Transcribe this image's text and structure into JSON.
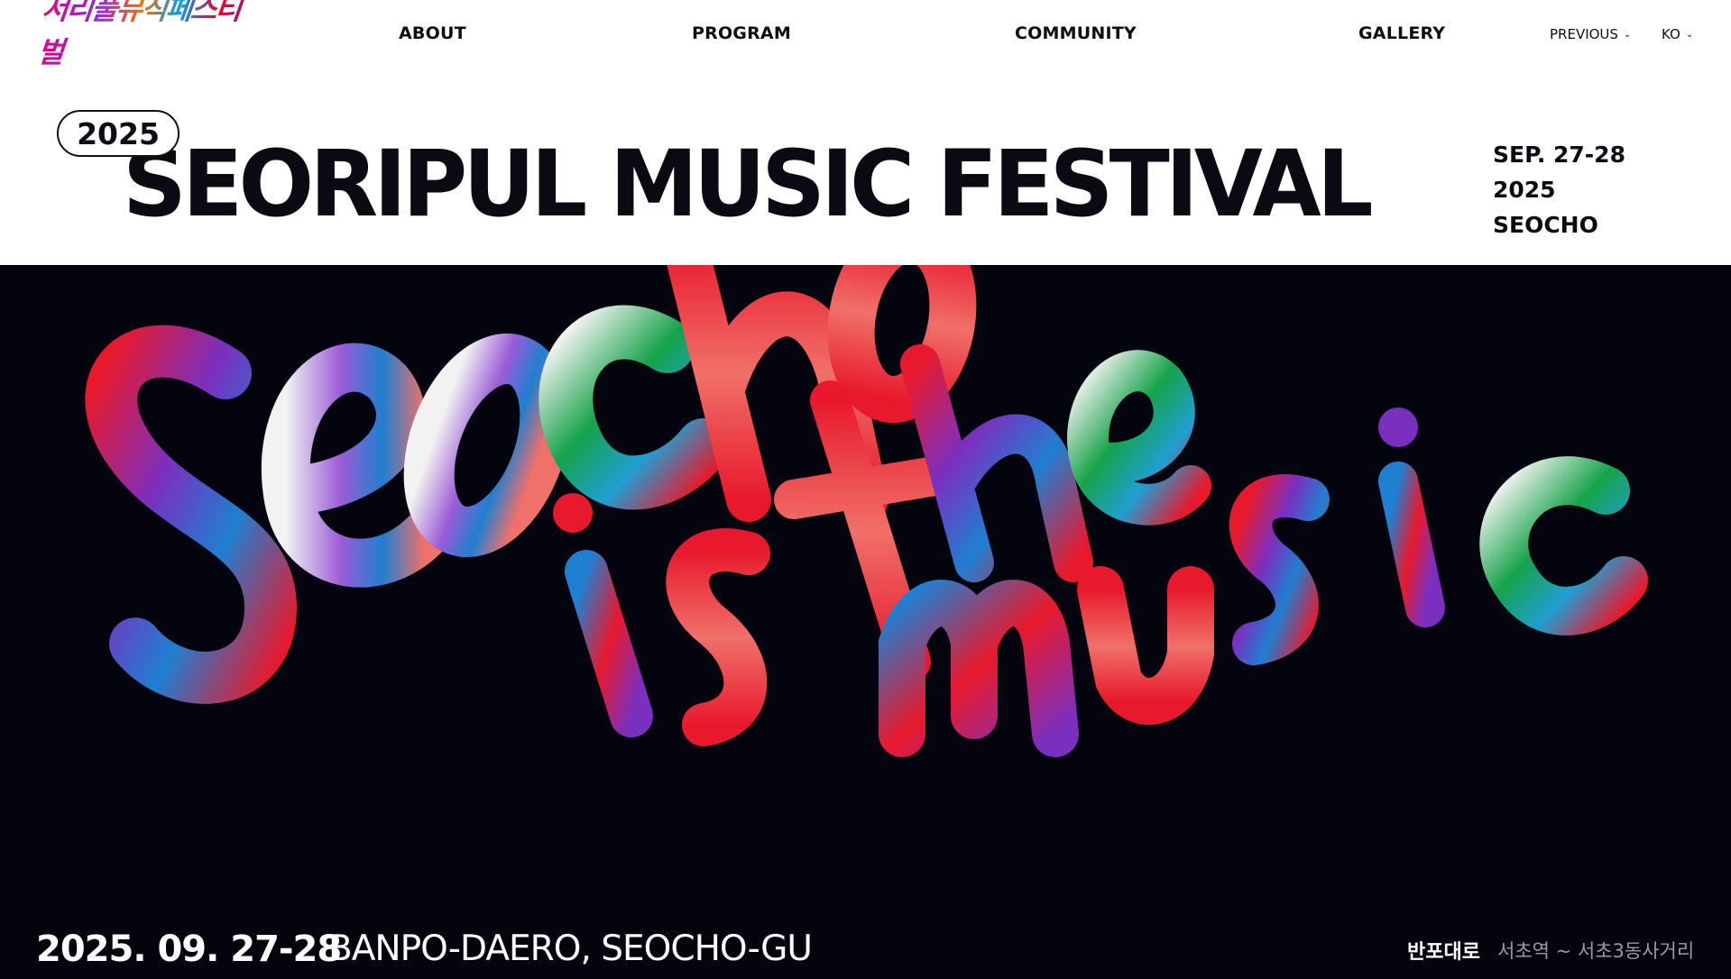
{
  "nav": {
    "logo_text": "서리풀뮤직페스티벌",
    "menu": {
      "about": "ABOUT",
      "program": "PROGRAM",
      "community": "COMMUNITY",
      "gallery": "GALLERY"
    },
    "previous_label": "PREVIOUS",
    "language_label": "KO"
  },
  "title_band": {
    "year": "2025",
    "title": "SEORIPUL MUSIC FESTIVAL",
    "date_line": "SEP. 27-28",
    "year_line": "2025",
    "location_line": "SEOCHO"
  },
  "hero": {
    "artwork_text_line1": "Seocho",
    "artwork_text_line2": "is the",
    "artwork_text_line3": "music",
    "background_color": "#04040e",
    "paint_colors": [
      "#e8192c",
      "#f0706a",
      "#7b2fbf",
      "#1f7fd1",
      "#16a34a",
      "#f2f2f2",
      "#e45bd6"
    ]
  },
  "footer": {
    "date": "2025. 09. 27-28",
    "venue": "BANPO-DAERO, SEOCHO-GU",
    "road_name": "반포대로",
    "route": "서초역 ~ 서초3동사거리"
  }
}
